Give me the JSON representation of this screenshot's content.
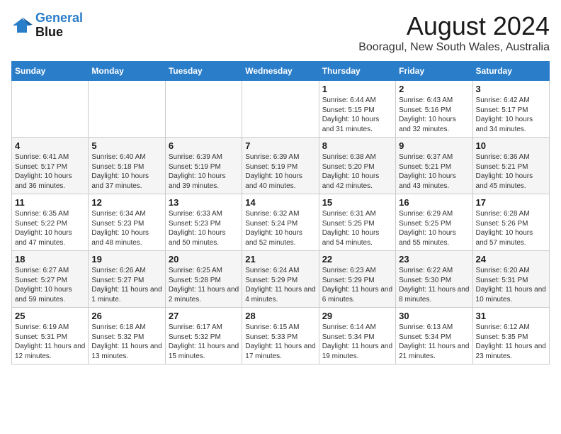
{
  "logo": {
    "line1": "General",
    "line2": "Blue"
  },
  "title": "August 2024",
  "subtitle": "Booragul, New South Wales, Australia",
  "days_of_week": [
    "Sunday",
    "Monday",
    "Tuesday",
    "Wednesday",
    "Thursday",
    "Friday",
    "Saturday"
  ],
  "weeks": [
    [
      {
        "day": "",
        "sunrise": "",
        "sunset": "",
        "daylight": ""
      },
      {
        "day": "",
        "sunrise": "",
        "sunset": "",
        "daylight": ""
      },
      {
        "day": "",
        "sunrise": "",
        "sunset": "",
        "daylight": ""
      },
      {
        "day": "",
        "sunrise": "",
        "sunset": "",
        "daylight": ""
      },
      {
        "day": "1",
        "sunrise": "6:44 AM",
        "sunset": "5:15 PM",
        "daylight": "10 hours and 31 minutes."
      },
      {
        "day": "2",
        "sunrise": "6:43 AM",
        "sunset": "5:16 PM",
        "daylight": "10 hours and 32 minutes."
      },
      {
        "day": "3",
        "sunrise": "6:42 AM",
        "sunset": "5:17 PM",
        "daylight": "10 hours and 34 minutes."
      }
    ],
    [
      {
        "day": "4",
        "sunrise": "6:41 AM",
        "sunset": "5:17 PM",
        "daylight": "10 hours and 36 minutes."
      },
      {
        "day": "5",
        "sunrise": "6:40 AM",
        "sunset": "5:18 PM",
        "daylight": "10 hours and 37 minutes."
      },
      {
        "day": "6",
        "sunrise": "6:39 AM",
        "sunset": "5:19 PM",
        "daylight": "10 hours and 39 minutes."
      },
      {
        "day": "7",
        "sunrise": "6:39 AM",
        "sunset": "5:19 PM",
        "daylight": "10 hours and 40 minutes."
      },
      {
        "day": "8",
        "sunrise": "6:38 AM",
        "sunset": "5:20 PM",
        "daylight": "10 hours and 42 minutes."
      },
      {
        "day": "9",
        "sunrise": "6:37 AM",
        "sunset": "5:21 PM",
        "daylight": "10 hours and 43 minutes."
      },
      {
        "day": "10",
        "sunrise": "6:36 AM",
        "sunset": "5:21 PM",
        "daylight": "10 hours and 45 minutes."
      }
    ],
    [
      {
        "day": "11",
        "sunrise": "6:35 AM",
        "sunset": "5:22 PM",
        "daylight": "10 hours and 47 minutes."
      },
      {
        "day": "12",
        "sunrise": "6:34 AM",
        "sunset": "5:23 PM",
        "daylight": "10 hours and 48 minutes."
      },
      {
        "day": "13",
        "sunrise": "6:33 AM",
        "sunset": "5:23 PM",
        "daylight": "10 hours and 50 minutes."
      },
      {
        "day": "14",
        "sunrise": "6:32 AM",
        "sunset": "5:24 PM",
        "daylight": "10 hours and 52 minutes."
      },
      {
        "day": "15",
        "sunrise": "6:31 AM",
        "sunset": "5:25 PM",
        "daylight": "10 hours and 54 minutes."
      },
      {
        "day": "16",
        "sunrise": "6:29 AM",
        "sunset": "5:25 PM",
        "daylight": "10 hours and 55 minutes."
      },
      {
        "day": "17",
        "sunrise": "6:28 AM",
        "sunset": "5:26 PM",
        "daylight": "10 hours and 57 minutes."
      }
    ],
    [
      {
        "day": "18",
        "sunrise": "6:27 AM",
        "sunset": "5:27 PM",
        "daylight": "10 hours and 59 minutes."
      },
      {
        "day": "19",
        "sunrise": "6:26 AM",
        "sunset": "5:27 PM",
        "daylight": "11 hours and 1 minute."
      },
      {
        "day": "20",
        "sunrise": "6:25 AM",
        "sunset": "5:28 PM",
        "daylight": "11 hours and 2 minutes."
      },
      {
        "day": "21",
        "sunrise": "6:24 AM",
        "sunset": "5:29 PM",
        "daylight": "11 hours and 4 minutes."
      },
      {
        "day": "22",
        "sunrise": "6:23 AM",
        "sunset": "5:29 PM",
        "daylight": "11 hours and 6 minutes."
      },
      {
        "day": "23",
        "sunrise": "6:22 AM",
        "sunset": "5:30 PM",
        "daylight": "11 hours and 8 minutes."
      },
      {
        "day": "24",
        "sunrise": "6:20 AM",
        "sunset": "5:31 PM",
        "daylight": "11 hours and 10 minutes."
      }
    ],
    [
      {
        "day": "25",
        "sunrise": "6:19 AM",
        "sunset": "5:31 PM",
        "daylight": "11 hours and 12 minutes."
      },
      {
        "day": "26",
        "sunrise": "6:18 AM",
        "sunset": "5:32 PM",
        "daylight": "11 hours and 13 minutes."
      },
      {
        "day": "27",
        "sunrise": "6:17 AM",
        "sunset": "5:32 PM",
        "daylight": "11 hours and 15 minutes."
      },
      {
        "day": "28",
        "sunrise": "6:15 AM",
        "sunset": "5:33 PM",
        "daylight": "11 hours and 17 minutes."
      },
      {
        "day": "29",
        "sunrise": "6:14 AM",
        "sunset": "5:34 PM",
        "daylight": "11 hours and 19 minutes."
      },
      {
        "day": "30",
        "sunrise": "6:13 AM",
        "sunset": "5:34 PM",
        "daylight": "11 hours and 21 minutes."
      },
      {
        "day": "31",
        "sunrise": "6:12 AM",
        "sunset": "5:35 PM",
        "daylight": "11 hours and 23 minutes."
      }
    ]
  ]
}
